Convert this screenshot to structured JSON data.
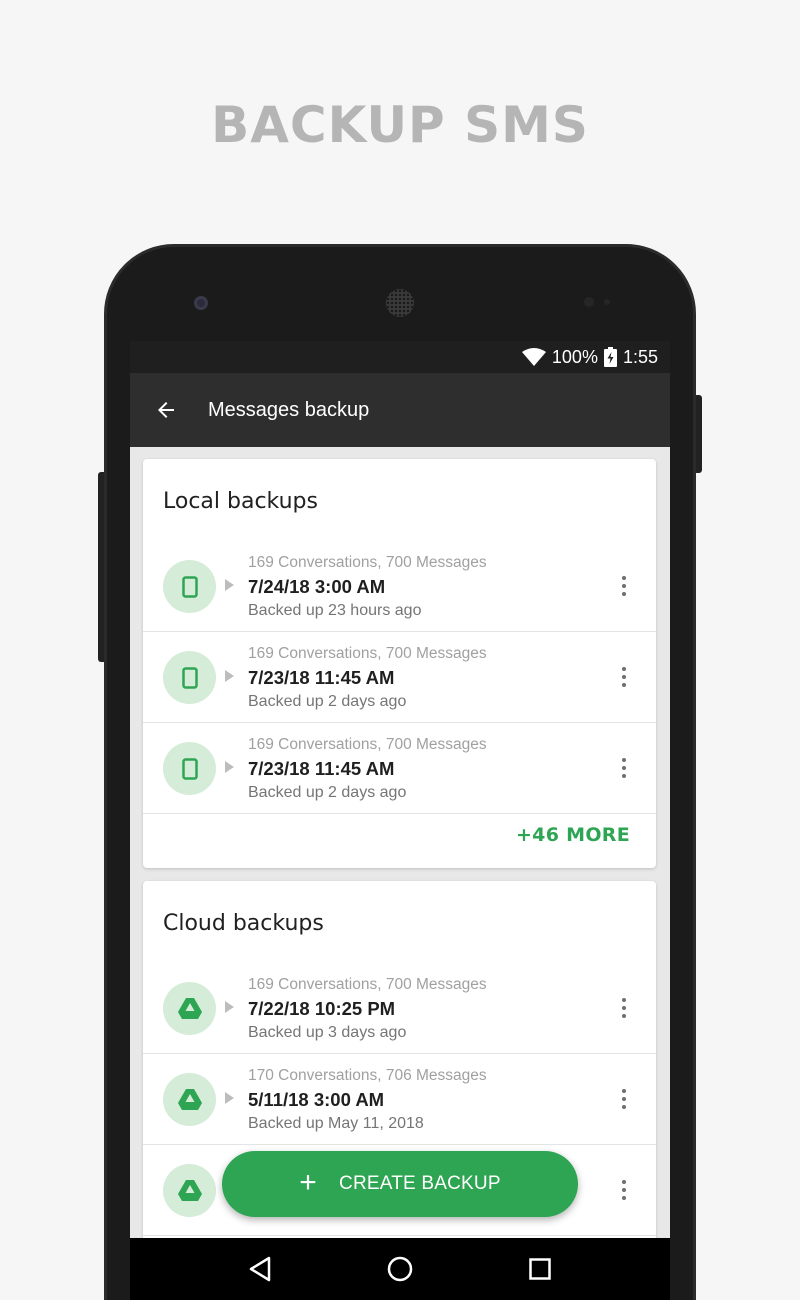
{
  "headline": "BACKUP SMS",
  "status_bar": {
    "battery": "100%",
    "time": "1:55"
  },
  "app_bar": {
    "title": "Messages backup"
  },
  "local_backups": {
    "title": "Local backups",
    "items": [
      {
        "meta": "169 Conversations, 700 Messages",
        "date": "7/24/18 3:00 AM",
        "ago": "Backed up 23 hours ago",
        "icon": "phone-icon"
      },
      {
        "meta": "169 Conversations, 700 Messages",
        "date": "7/23/18 11:45 AM",
        "ago": "Backed up 2 days ago",
        "icon": "phone-icon"
      },
      {
        "meta": "169 Conversations, 700 Messages",
        "date": "7/23/18 11:45 AM",
        "ago": "Backed up 2 days ago",
        "icon": "phone-icon"
      }
    ],
    "more_label": "+46 MORE"
  },
  "cloud_backups": {
    "title": "Cloud backups",
    "items": [
      {
        "meta": "169 Conversations, 700 Messages",
        "date": "7/22/18 10:25 PM",
        "ago": "Backed up 3 days ago",
        "icon": "google-drive-icon"
      },
      {
        "meta": "170 Conversations, 706 Messages",
        "date": "5/11/18 3:00 AM",
        "ago": "Backed up May 11, 2018",
        "icon": "google-drive-icon"
      },
      {
        "meta": "",
        "date": "",
        "ago": "",
        "icon": "google-drive-icon"
      }
    ]
  },
  "fab": {
    "label": "CREATE BACKUP",
    "icon": "plus-icon"
  },
  "colors": {
    "accent": "#2ea552",
    "icon_bg": "#d4ecd8",
    "app_bar": "#2e2e2e"
  }
}
